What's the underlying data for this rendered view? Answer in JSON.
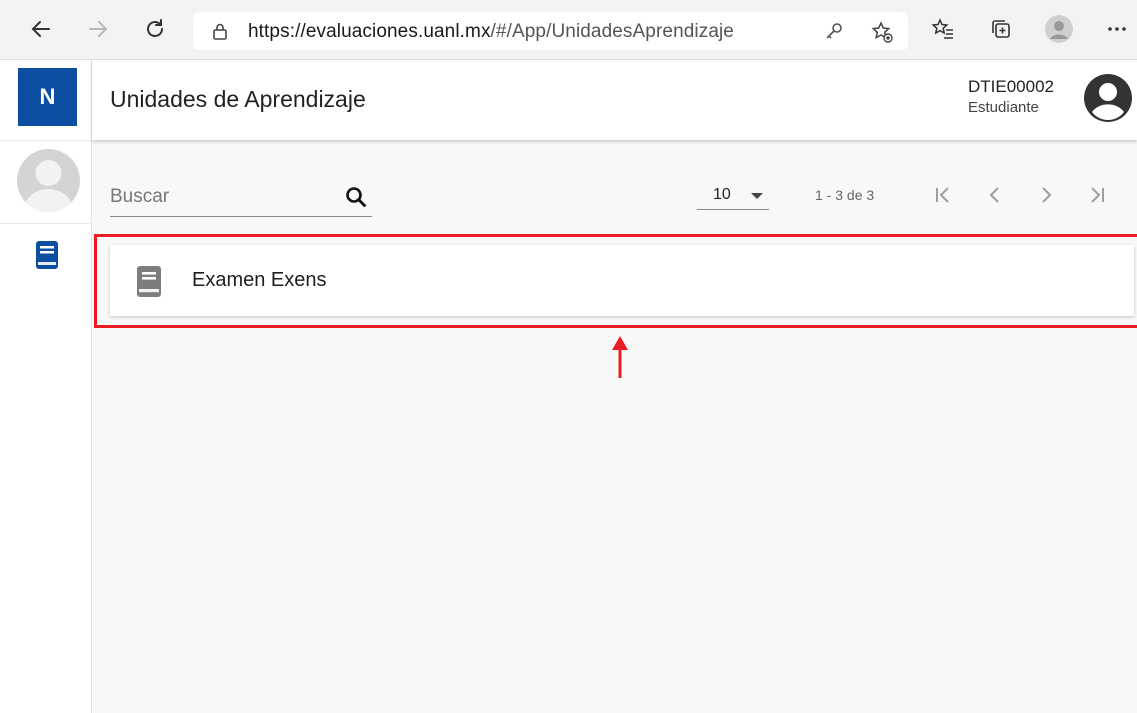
{
  "browser": {
    "url_host": "https://evaluaciones.uanl.mx",
    "url_path": "/#/App/UnidadesAprendizaje"
  },
  "sidebar": {
    "logo_text": "N"
  },
  "header": {
    "title": "Unidades de Aprendizaje",
    "user_id": "DTIE00002",
    "user_role": "Estudiante"
  },
  "toolbar": {
    "search_placeholder": "Buscar",
    "page_size": "10",
    "range_label": "1 - 3 de 3"
  },
  "units": [
    {
      "title": "Examen Exens"
    }
  ],
  "colors": {
    "brand": "#0b4ea2",
    "sidebar_book": "#0b4ea2",
    "highlight": "#ec1c24"
  }
}
